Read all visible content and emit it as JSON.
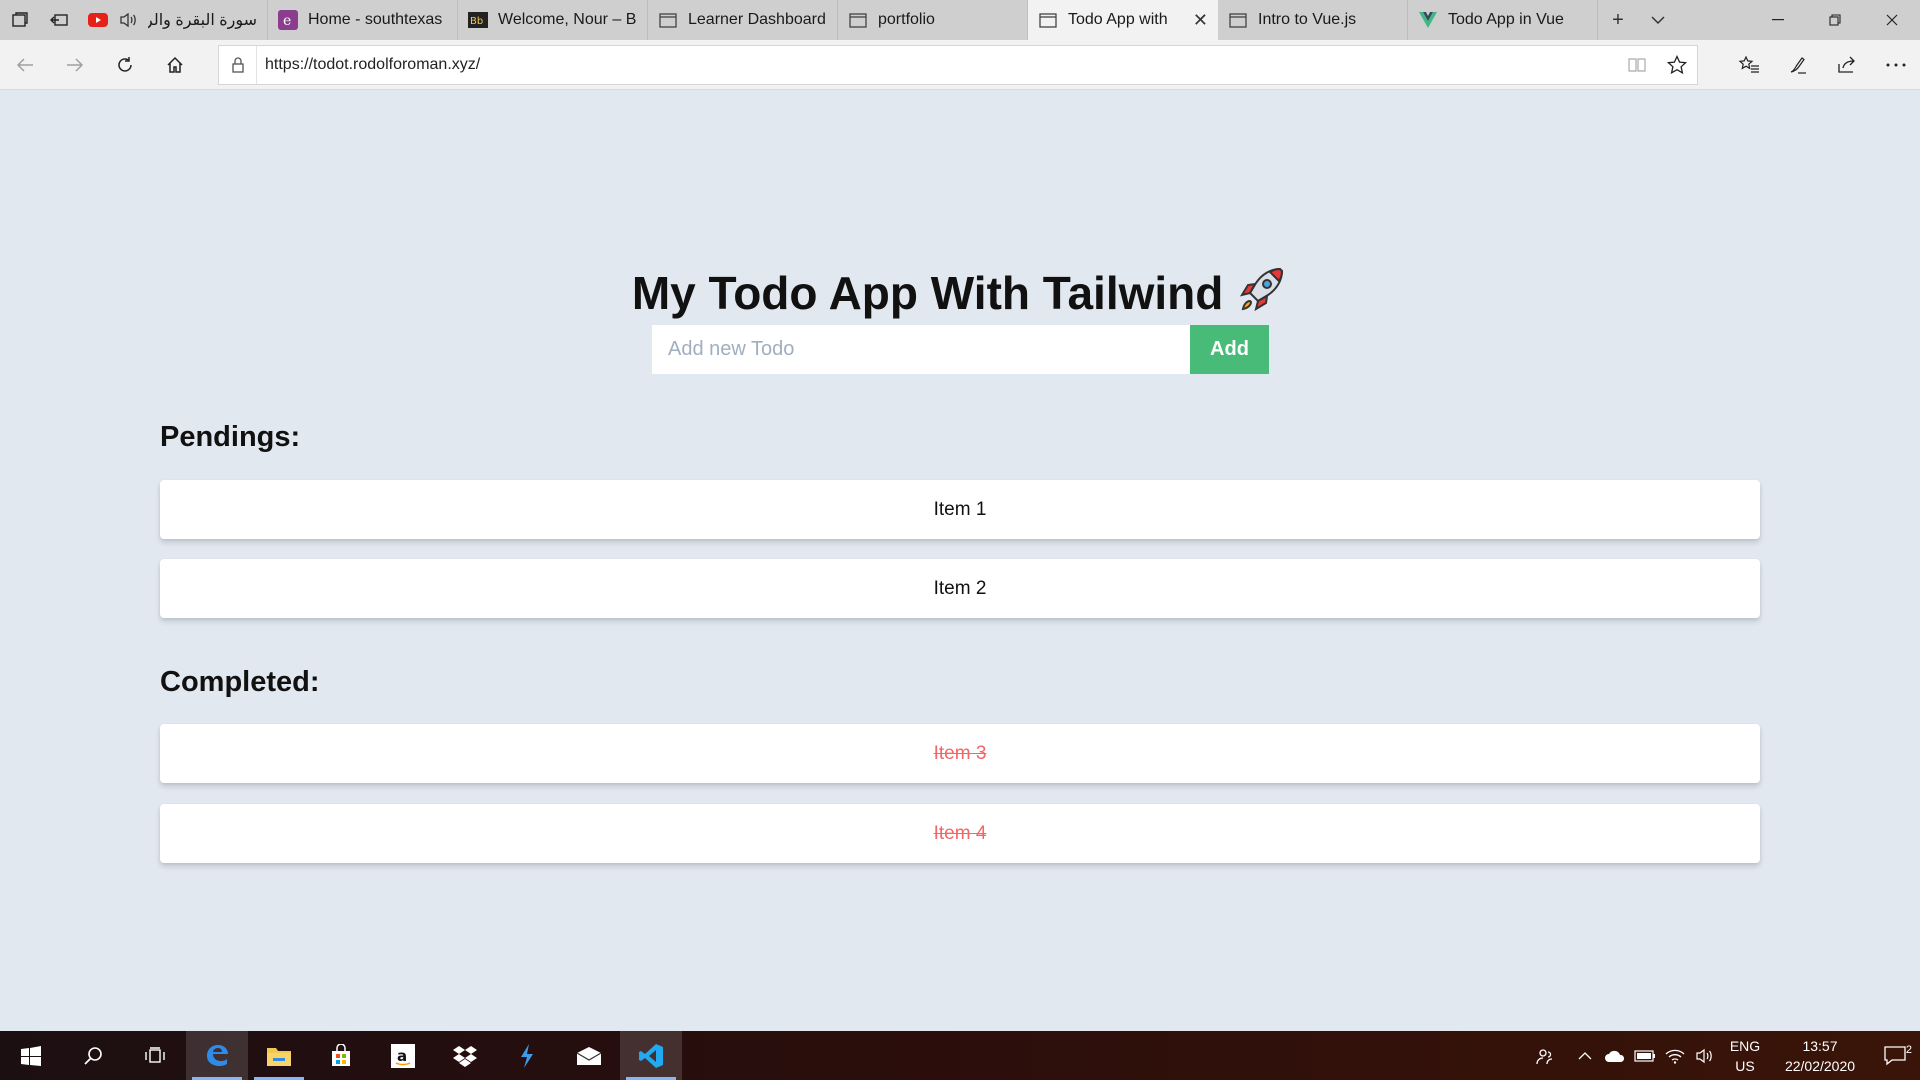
{
  "browser": {
    "tabs": [
      {
        "label": "سورة البقرة والر",
        "icon": "youtube-icon",
        "audio": true
      },
      {
        "label": "Home - southtexas",
        "icon": "e-brand-icon"
      },
      {
        "label": "Welcome, Nour – B",
        "icon": "bb-icon"
      },
      {
        "label": "Learner Dashboard",
        "icon": "page-icon"
      },
      {
        "label": "portfolio",
        "icon": "page-icon"
      },
      {
        "label": "Todo App with",
        "icon": "page-icon",
        "active": true
      },
      {
        "label": "Intro to Vue.js",
        "icon": "page-icon"
      },
      {
        "label": "Todo App in Vue",
        "icon": "vue-icon"
      }
    ],
    "url": "https://todot.rodolforoman.xyz/"
  },
  "app": {
    "title": "My Todo App With Tailwind",
    "title_emoji": "🚀",
    "input_placeholder": "Add new Todo",
    "add_label": "Add",
    "pending_heading": "Pendings:",
    "pending_items": [
      "Item 1",
      "Item 2"
    ],
    "completed_heading": "Completed:",
    "completed_items": [
      "Item 3",
      "Item 4"
    ]
  },
  "taskbar": {
    "lang_line1": "ENG",
    "lang_line2": "US",
    "time": "13:57",
    "date": "22/02/2020",
    "notification_count": "2"
  },
  "colors": {
    "page_bg": "#e2e8f0",
    "add_button": "#48bb78",
    "completed_text": "#f56565"
  }
}
